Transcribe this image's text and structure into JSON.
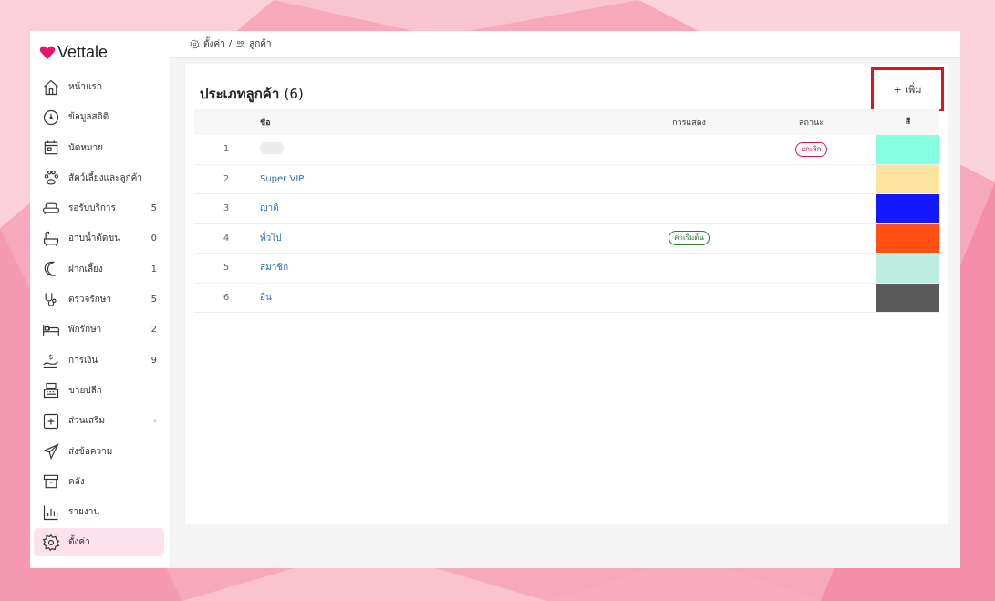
{
  "app": {
    "brand": "Vettale",
    "brand_color": "#e8146c"
  },
  "breadcrumb": {
    "root": "ตั้งค่า",
    "separator": "/",
    "current": "ลูกค้า"
  },
  "sidebar": {
    "items": [
      {
        "label": "หน้าแรก",
        "icon": "home-icon",
        "count": ""
      },
      {
        "label": "ข้อมูลสถิติ",
        "icon": "dashboard-icon",
        "count": ""
      },
      {
        "label": "นัดหมาย",
        "icon": "calendar-icon",
        "count": ""
      },
      {
        "label": "สัตว์เลี้ยงและลูกค้า",
        "icon": "paw-icon",
        "count": ""
      },
      {
        "label": "รอรับบริการ",
        "icon": "sofa-icon",
        "count": "5"
      },
      {
        "label": "อาบน้ำตัดขน",
        "icon": "bathtub-icon",
        "count": "0"
      },
      {
        "label": "ฝากเลี้ยง",
        "icon": "moon-icon",
        "count": "1"
      },
      {
        "label": "ตรวจรักษา",
        "icon": "stethoscope-icon",
        "count": "5"
      },
      {
        "label": "พักรักษา",
        "icon": "bed-icon",
        "count": "2"
      },
      {
        "label": "การเงิน",
        "icon": "money-hand-icon",
        "count": "9"
      },
      {
        "label": "ขายปลีก",
        "icon": "cash-register-icon",
        "count": ""
      },
      {
        "label": "ส่วนเสริม",
        "icon": "plus-square-icon",
        "count": "›"
      },
      {
        "label": "ส่งข้อความ",
        "icon": "send-icon",
        "count": ""
      },
      {
        "label": "คลัง",
        "icon": "archive-icon",
        "count": ""
      },
      {
        "label": "รายงาน",
        "icon": "bar-chart-icon",
        "count": ""
      },
      {
        "label": "ตั้งค่า",
        "icon": "gear-icon",
        "count": ""
      }
    ]
  },
  "card": {
    "title": "ประเภทลูกค้า",
    "count": "(6)",
    "add_label": "+ เพิ่ม"
  },
  "table": {
    "headers": {
      "name": "ชื่อ",
      "display": "การแสดง",
      "status": "สถานะ",
      "color": "สี"
    },
    "rows": [
      {
        "idx": "1",
        "name": "",
        "display": "",
        "status": "ยกเลิก",
        "color": "#86ffe1"
      },
      {
        "idx": "2",
        "name": "Super VIP",
        "display": "",
        "status": "",
        "color": "#fbe49e"
      },
      {
        "idx": "3",
        "name": "ญาติ",
        "display": "",
        "status": "",
        "color": "#1418ff"
      },
      {
        "idx": "4",
        "name": "ทั่วไป",
        "display": "ค่าเริ่มต้น",
        "status": "",
        "color": "#ff4f13"
      },
      {
        "idx": "5",
        "name": "สมาชิก",
        "display": "",
        "status": "",
        "color": "#bdece0"
      },
      {
        "idx": "6",
        "name": "อื่น",
        "display": "",
        "status": "",
        "color": "#595959"
      }
    ]
  }
}
